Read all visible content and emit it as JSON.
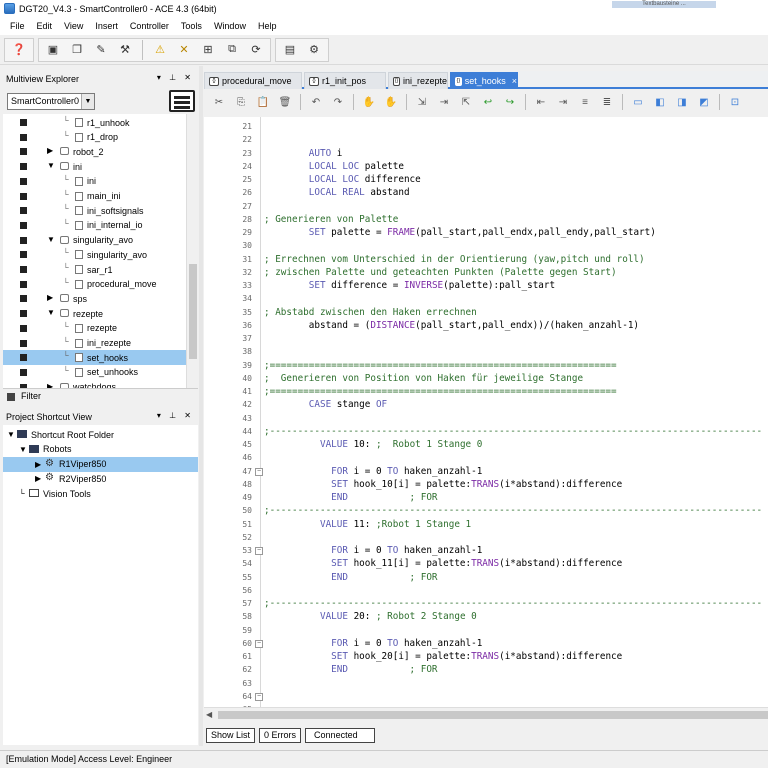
{
  "window": {
    "title": "DGT20_V4.3 - SmartController0 - ACE 4.3 (64bit)",
    "top_right_text": "Textbausteine ..."
  },
  "menu": [
    "File",
    "Edit",
    "View",
    "Insert",
    "Controller",
    "Tools",
    "Window",
    "Help"
  ],
  "multiview": {
    "title": "Multiview Explorer",
    "controller_select": "SmartController0",
    "items": [
      {
        "label": "r1_unhook",
        "level": 3,
        "type": "file"
      },
      {
        "label": "r1_drop",
        "level": 3,
        "type": "file"
      },
      {
        "label": "robot_2",
        "level": 2,
        "type": "folder",
        "expander": "▶"
      },
      {
        "label": "ini",
        "level": 2,
        "type": "folder",
        "expander": "▼"
      },
      {
        "label": "ini",
        "level": 3,
        "type": "file"
      },
      {
        "label": "main_ini",
        "level": 3,
        "type": "file"
      },
      {
        "label": "ini_softsignals",
        "level": 3,
        "type": "file"
      },
      {
        "label": "ini_internal_io",
        "level": 3,
        "type": "file"
      },
      {
        "label": "singularity_avo",
        "level": 2,
        "type": "folder",
        "expander": "▼"
      },
      {
        "label": "singularity_avo",
        "level": 3,
        "type": "file"
      },
      {
        "label": "sar_r1",
        "level": 3,
        "type": "file"
      },
      {
        "label": "procedural_move",
        "level": 3,
        "type": "file"
      },
      {
        "label": "sps",
        "level": 2,
        "type": "folder",
        "expander": "▶"
      },
      {
        "label": "rezepte",
        "level": 2,
        "type": "folder",
        "expander": "▼"
      },
      {
        "label": "rezepte",
        "level": 3,
        "type": "file"
      },
      {
        "label": "ini_rezepte",
        "level": 3,
        "type": "file"
      },
      {
        "label": "set_hooks",
        "level": 3,
        "type": "file",
        "selected": true
      },
      {
        "label": "set_unhooks",
        "level": 3,
        "type": "file"
      },
      {
        "label": "watchdogs",
        "level": 2,
        "type": "folder",
        "expander": "▶"
      }
    ],
    "filter_label": "Filter"
  },
  "shortcut_view": {
    "title": "Project Shortcut View",
    "items": [
      {
        "label": "Shortcut Root Folder",
        "x": 4,
        "expander": "▼",
        "icon": "folder"
      },
      {
        "label": "Robots",
        "x": 16,
        "expander": "▼",
        "icon": "folder"
      },
      {
        "label": "R1Viper850",
        "x": 32,
        "expander": "▶",
        "icon": "robot",
        "selected": true
      },
      {
        "label": "R2Viper850",
        "x": 32,
        "expander": "▶",
        "icon": "robot"
      },
      {
        "label": "Vision Tools",
        "x": 16,
        "expander": "",
        "icon": "folder"
      }
    ]
  },
  "tabs": [
    {
      "label": "procedural_move",
      "active": false
    },
    {
      "label": "r1_init_pos",
      "active": false
    },
    {
      "label": "ini_rezepte",
      "active": false
    },
    {
      "label": "set_hooks",
      "active": true,
      "close": "×"
    }
  ],
  "code_lines": [
    {
      "n": "21",
      "t": ""
    },
    {
      "n": "22",
      "t": ""
    },
    {
      "n": "23",
      "t": "        AUTO i"
    },
    {
      "n": "24",
      "t": "        LOCAL LOC palette"
    },
    {
      "n": "25",
      "t": "        LOCAL LOC difference"
    },
    {
      "n": "26",
      "t": "        LOCAL REAL abstand"
    },
    {
      "n": "27",
      "t": ""
    },
    {
      "n": "28",
      "t": "; Generieren von Palette"
    },
    {
      "n": "29",
      "t": "        SET palette = FRAME(pall_start,pall_endx,pall_endy,pall_start)"
    },
    {
      "n": "30",
      "t": ""
    },
    {
      "n": "31",
      "t": "; Errechnen vom Unterschied in der Orientierung (yaw,pitch und roll)"
    },
    {
      "n": "32",
      "t": "; zwischen Palette und geteachten Punkten (Palette gegen Start)"
    },
    {
      "n": "33",
      "t": "        SET difference = INVERSE(palette):pall_start"
    },
    {
      "n": "34",
      "t": ""
    },
    {
      "n": "35",
      "t": "; Abstabd zwischen den Haken errechnen"
    },
    {
      "n": "36",
      "t": "        abstand = (DISTANCE(pall_start,pall_endx))/(haken_anzahl-1)"
    },
    {
      "n": "37",
      "t": ""
    },
    {
      "n": "38",
      "t": ""
    },
    {
      "n": "39",
      "t": ";=============================================================="
    },
    {
      "n": "40",
      "t": ";  Generieren von Position von Haken für jeweilige Stange"
    },
    {
      "n": "41",
      "t": ";=============================================================="
    },
    {
      "n": "42",
      "t": "        CASE stange OF"
    },
    {
      "n": "43",
      "t": ""
    },
    {
      "n": "44",
      "t": ";----------------------------------------------------------------------------------------"
    },
    {
      "n": "45",
      "t": "          VALUE 10: ;  Robot 1 Stange 0"
    },
    {
      "n": "46",
      "t": ""
    },
    {
      "n": "47",
      "t": "            FOR i = 0 TO haken_anzahl-1"
    },
    {
      "n": "48",
      "t": "            SET hook_10[i] = palette:TRANS(i*abstand):difference"
    },
    {
      "n": "49",
      "t": "            END           ; FOR"
    },
    {
      "n": "50",
      "t": ";----------------------------------------------------------------------------------------"
    },
    {
      "n": "51",
      "t": "          VALUE 11: ;Robot 1 Stange 1"
    },
    {
      "n": "52",
      "t": ""
    },
    {
      "n": "53",
      "t": "            FOR i = 0 TO haken_anzahl-1"
    },
    {
      "n": "54",
      "t": "            SET hook_11[i] = palette:TRANS(i*abstand):difference"
    },
    {
      "n": "55",
      "t": "            END           ; FOR"
    },
    {
      "n": "56",
      "t": ""
    },
    {
      "n": "57",
      "t": ";----------------------------------------------------------------------------------------"
    },
    {
      "n": "58",
      "t": "          VALUE 20: ; Robot 2 Stange 0"
    },
    {
      "n": "59",
      "t": ""
    },
    {
      "n": "60",
      "t": "            FOR i = 0 TO haken_anzahl-1"
    },
    {
      "n": "61",
      "t": "            SET hook_20[i] = palette:TRANS(i*abstand):difference"
    },
    {
      "n": "62",
      "t": "            END           ; FOR"
    },
    {
      "n": "63",
      "t": ""
    },
    {
      "n": "64",
      "t": ""
    },
    {
      "n": "65",
      "t": ";----------------------------------------------------------------------------------------"
    }
  ],
  "status_buttons": {
    "show_list": "Show List",
    "errors": "0 Errors",
    "connected": "Connected"
  },
  "bottom_status": "[Emulation Mode] Access Level: Engineer"
}
